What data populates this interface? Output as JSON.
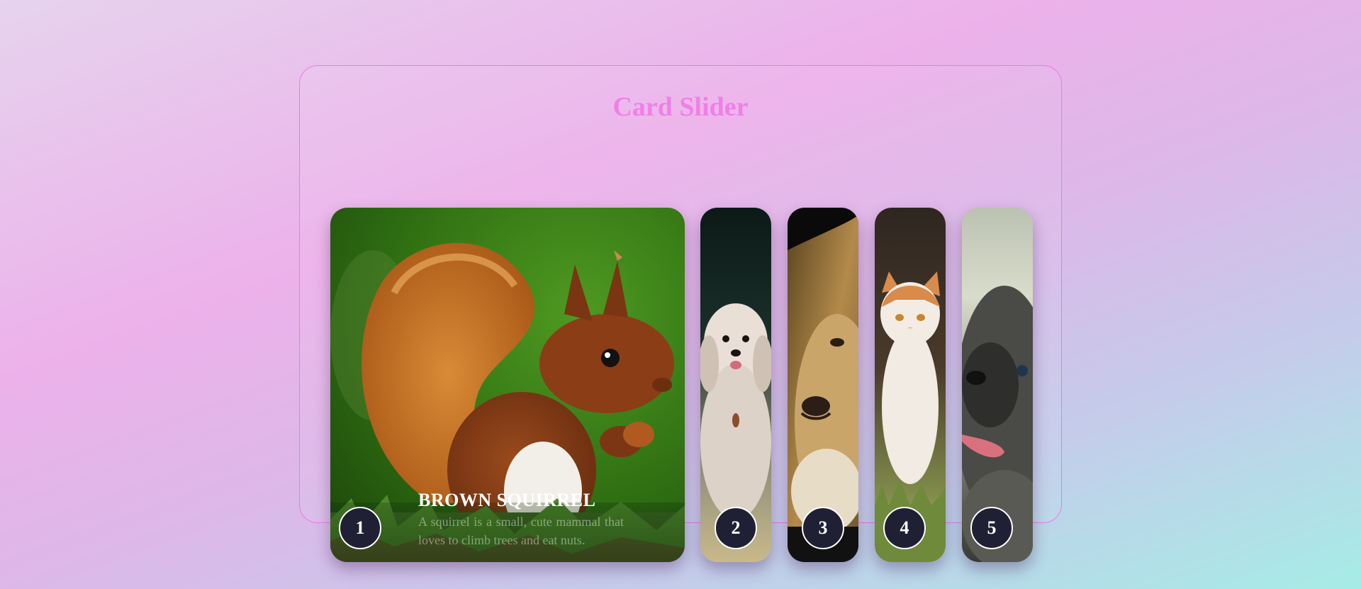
{
  "slider": {
    "title": "Card Slider",
    "accent_color": "#f07fe7",
    "cards": [
      {
        "number": "1",
        "image": "squirrel-photo",
        "active": true,
        "heading": "Brown Squirrel",
        "description": "A squirrel is a small, cute mammal that loves to climb trees and eat nuts."
      },
      {
        "number": "2",
        "image": "shih-tzu-dog-photo",
        "active": false
      },
      {
        "number": "3",
        "image": "lion-photo",
        "active": false
      },
      {
        "number": "4",
        "image": "kitten-photo",
        "active": false
      },
      {
        "number": "5",
        "image": "pug-photo",
        "active": false
      }
    ]
  }
}
